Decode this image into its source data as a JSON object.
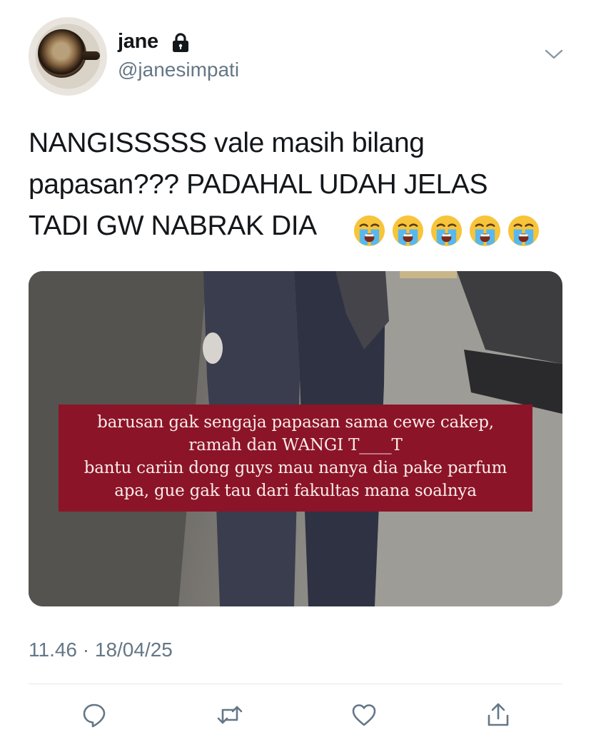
{
  "author": {
    "name": "jane",
    "handle": "@janesimpati",
    "protected_icon": "lock-icon",
    "avatar_icon": "coffee-cup-avatar"
  },
  "tweet": {
    "text": "NANGISSSSS vale masih bilang\npapasan??? PADAHAL UDAH JELAS\nTADI GW NABRAK DIA",
    "emojis": [
      "😭",
      "😭",
      "😭",
      "😭",
      "😭"
    ],
    "timestamp": "11.46 · 18/04/25"
  },
  "media": {
    "caption_lines": [
      "barusan gak sengaja papasan sama cewe cakep,",
      "ramah dan WANGI T____T",
      "bantu cariin dong guys mau nanya dia pake parfum",
      "apa, gue gak tau dari fakultas mana soalnya"
    ],
    "caption_bg": "#8c1428"
  },
  "actions": [
    {
      "name": "reply",
      "icon": "reply-icon"
    },
    {
      "name": "retweet",
      "icon": "retweet-icon"
    },
    {
      "name": "like",
      "icon": "heart-icon"
    },
    {
      "name": "share",
      "icon": "share-icon"
    }
  ],
  "colors": {
    "text": "#14171a",
    "secondary": "#657786",
    "icon": "#657786"
  }
}
